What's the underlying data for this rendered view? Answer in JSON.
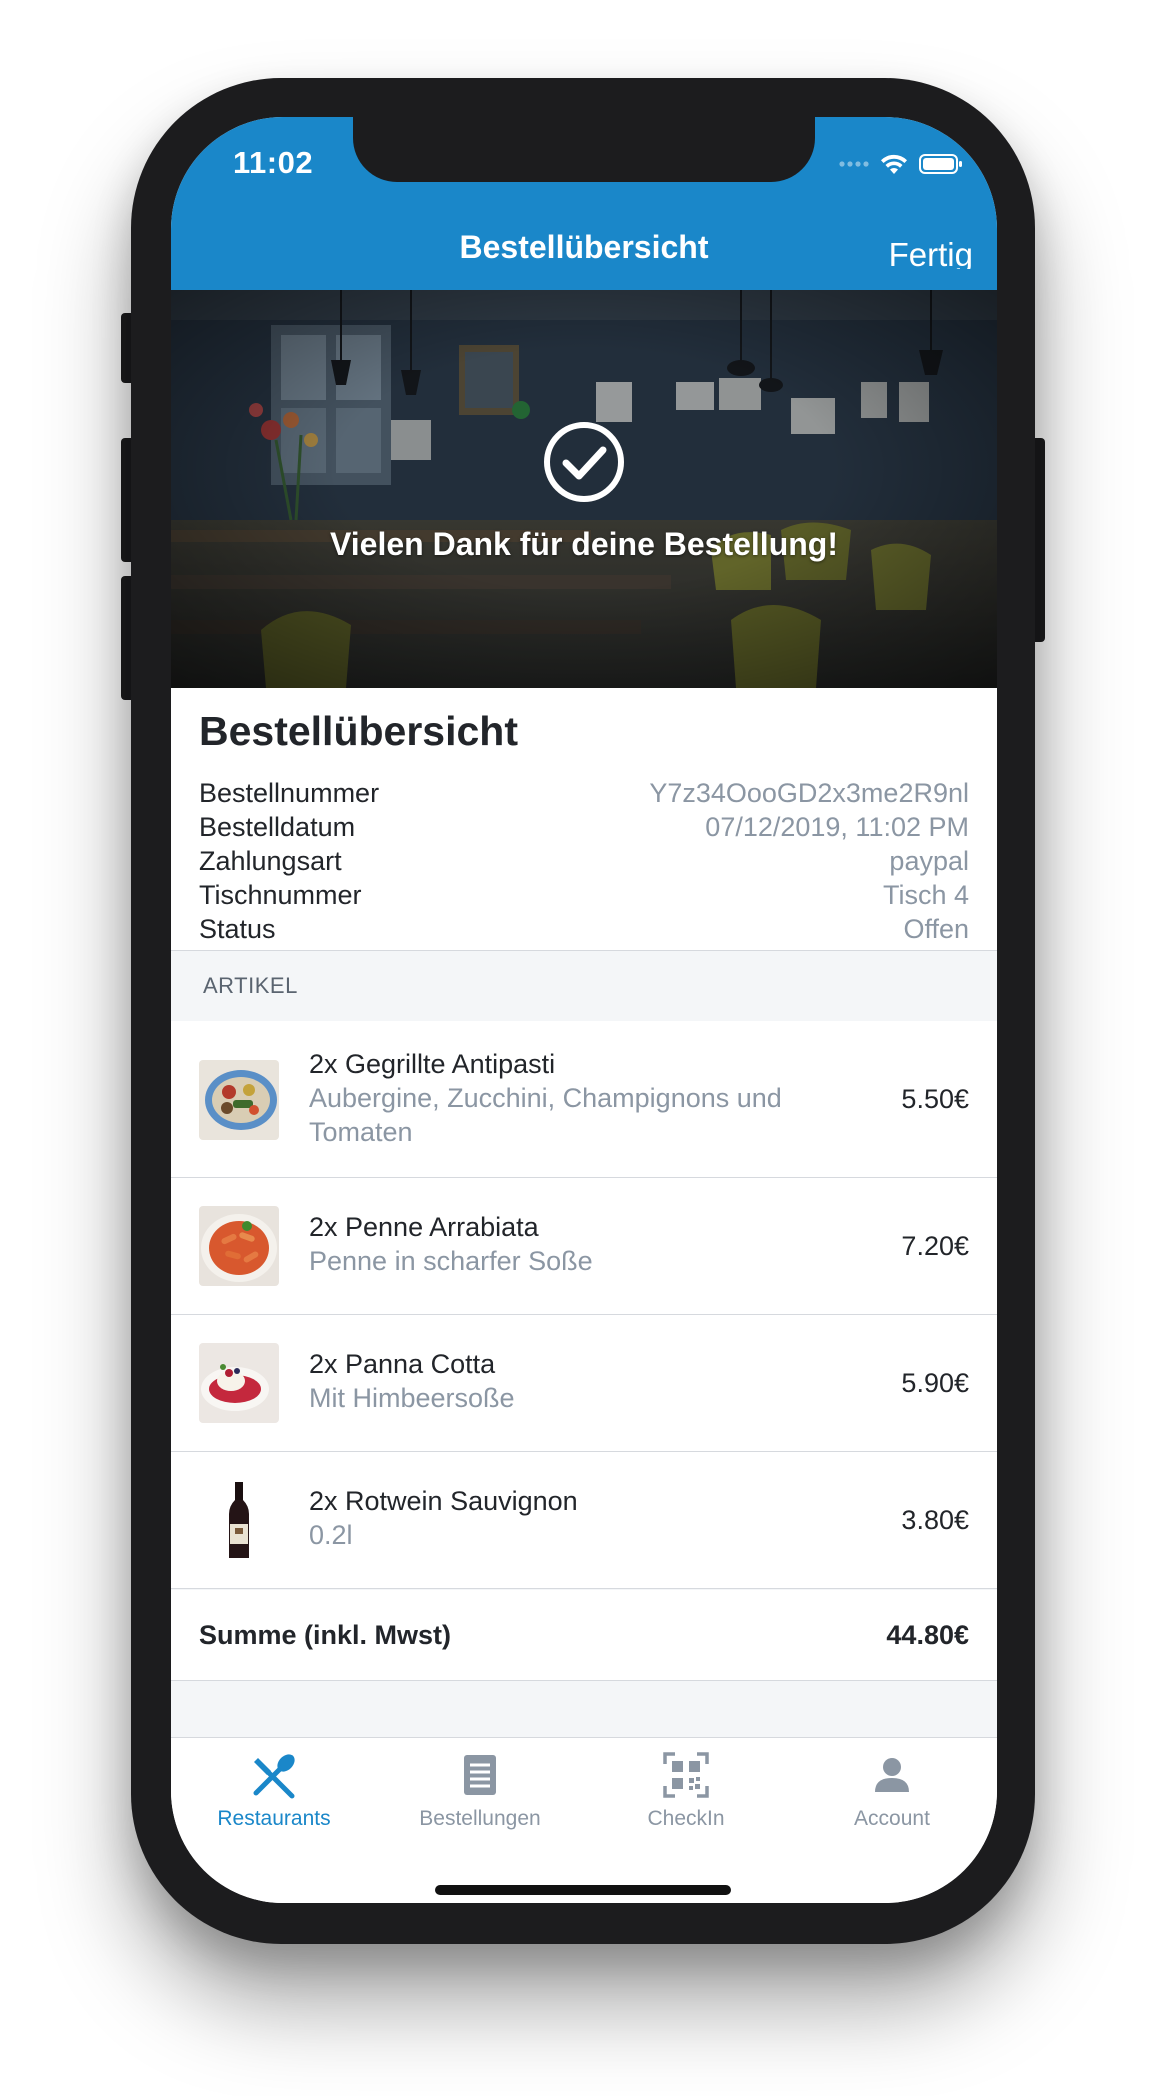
{
  "status_bar": {
    "time": "11:02"
  },
  "nav": {
    "title": "Bestellübersicht",
    "done_label": "Fertig"
  },
  "hero": {
    "message": "Vielen Dank für deine Bestellung!"
  },
  "summary": {
    "title": "Bestellübersicht",
    "rows": [
      {
        "label": "Bestellnummer",
        "value": "Y7z34OooGD2x3me2R9nl"
      },
      {
        "label": "Bestelldatum",
        "value": "07/12/2019, 11:02 PM"
      },
      {
        "label": "Zahlungsart",
        "value": "paypal"
      },
      {
        "label": "Tischnummer",
        "value": "Tisch 4"
      },
      {
        "label": "Status",
        "value": "Offen"
      }
    ]
  },
  "items_section": {
    "label": "ARTIKEL",
    "items": [
      {
        "name": "2x Gegrillte Antipasti",
        "description": "Aubergine, Zucchini, Champignons und Tomaten",
        "price": "5.50€",
        "image": "grilled-vegetables-photo"
      },
      {
        "name": "2x Penne Arrabiata",
        "description": "Penne in scharfer Soße",
        "price": "7.20€",
        "image": "penne-pasta-photo"
      },
      {
        "name": "2x Panna Cotta",
        "description": "Mit Himbeersoße",
        "price": "5.90€",
        "image": "panna-cotta-photo"
      },
      {
        "name": "2x Rotwein Sauvignon",
        "description": "0.2l",
        "price": "3.80€",
        "image": "wine-bottle-photo"
      }
    ]
  },
  "total": {
    "label": "Summe (inkl. Mwst)",
    "amount": "44.80€"
  },
  "tabbar": {
    "tabs": [
      {
        "label": "Restaurants",
        "icon": "fork-spoon-icon",
        "active": true
      },
      {
        "label": "Bestellungen",
        "icon": "receipt-icon",
        "active": false
      },
      {
        "label": "CheckIn",
        "icon": "qr-code-icon",
        "active": false
      },
      {
        "label": "Account",
        "icon": "user-icon",
        "active": false
      }
    ]
  },
  "colors": {
    "accent": "#1a87c9",
    "text": "#22252a",
    "muted": "#8b96a3",
    "background": "#f4f6f8"
  }
}
